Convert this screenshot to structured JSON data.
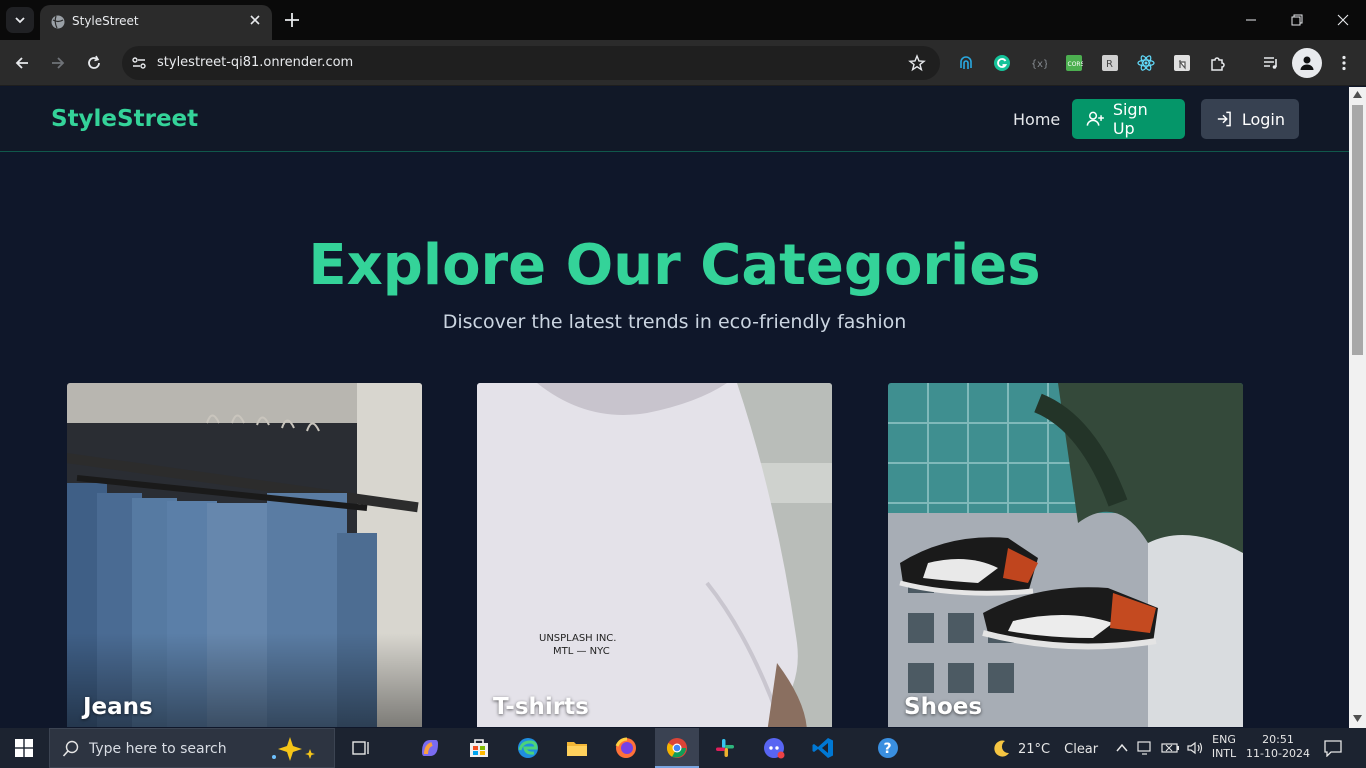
{
  "browser": {
    "tab_title": "StyleStreet",
    "url": "stylestreet-qi81.onrender.com"
  },
  "site": {
    "brand": "StyleStreet",
    "nav": {
      "home": "Home",
      "signup": "Sign Up",
      "login": "Login"
    },
    "hero": {
      "title": "Explore Our Categories",
      "subtitle": "Discover the latest trends in eco-friendly fashion"
    },
    "categories": [
      {
        "label": "Jeans"
      },
      {
        "label": "T-shirts",
        "shirt_print_1": "UNSPLASH INC.",
        "shirt_print_2": "MTL — NYC"
      },
      {
        "label": "Shoes"
      }
    ],
    "colors": {
      "accent": "#34d399",
      "signup_bg": "#059669",
      "login_bg": "#374151",
      "page_bg": "#0f172a"
    }
  },
  "taskbar": {
    "search_placeholder": "Type here to search",
    "weather_temp": "21°C",
    "weather_desc": "Clear",
    "lang_1": "ENG",
    "lang_2": "INTL",
    "time": "20:51",
    "date": "11-10-2024"
  }
}
